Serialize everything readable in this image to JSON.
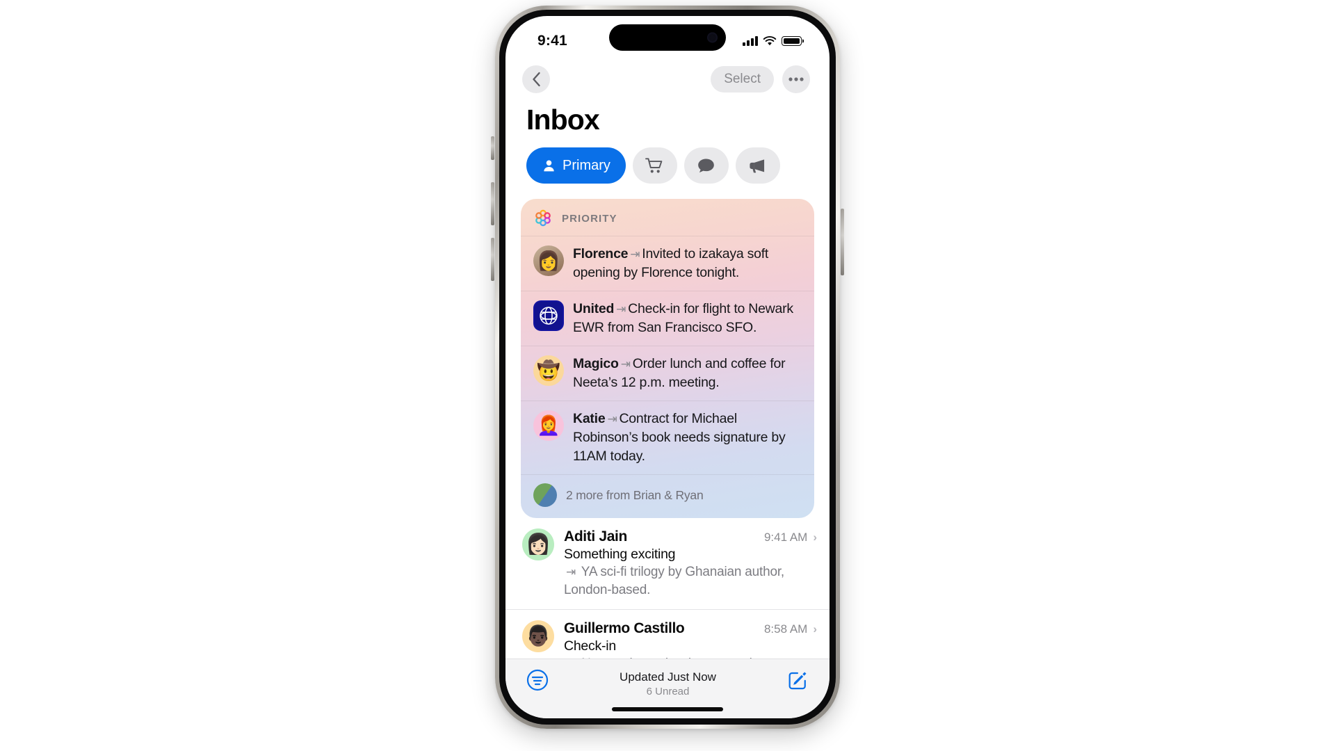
{
  "status_bar": {
    "time": "9:41",
    "cellular_icon": "signal-bars-icon",
    "wifi_icon": "wifi-icon",
    "battery_icon": "battery-full-icon"
  },
  "nav": {
    "back_icon": "chevron-left-icon",
    "select_label": "Select",
    "more_icon": "ellipsis-icon"
  },
  "page_title": "Inbox",
  "filters": [
    {
      "id": "primary",
      "label": "Primary",
      "icon": "person-icon",
      "active": true
    },
    {
      "id": "transactions",
      "label": "",
      "icon": "cart-icon",
      "active": false
    },
    {
      "id": "updates",
      "label": "",
      "icon": "chat-bubble-icon",
      "active": false
    },
    {
      "id": "promotions",
      "label": "",
      "icon": "megaphone-icon",
      "active": false
    }
  ],
  "priority": {
    "header_label": "PRIORITY",
    "header_icon": "apple-intelligence-icon",
    "items": [
      {
        "avatar": "👩",
        "sender": "Florence",
        "summary": "Invited to izakaya soft opening by Florence tonight."
      },
      {
        "avatar": "UA",
        "sender": "United",
        "summary": "Check-in for flight to Newark EWR from San Francisco SFO."
      },
      {
        "avatar": "🤠",
        "sender": "Magico",
        "summary": "Order lunch and coffee for Neeta’s 12 p.m. meeting."
      },
      {
        "avatar": "👩‍🦰",
        "sender": "Katie",
        "summary": "Contract for Michael Robinson’s book needs signature by 11AM today."
      }
    ],
    "more_label": "2 more from Brian & Ryan"
  },
  "messages": [
    {
      "avatar": "👩🏻",
      "sender": "Aditi Jain",
      "time": "9:41 AM",
      "subject": "Something exciting",
      "preview": "YA sci-fi trilogy by Ghanaian author, London-based.",
      "chevron": "chevron-right-icon"
    },
    {
      "avatar": "👨🏿",
      "sender": "Guillermo Castillo",
      "time": "8:58 AM",
      "subject": "Check-in",
      "preview": "Next major review in two weeks. Schedule meeting on Thursday at noon.",
      "chevron": "chevron-right-icon"
    }
  ],
  "bottom_bar": {
    "filter_icon": "mail-filter-icon",
    "updated_label": "Updated Just Now",
    "unread_label": "6 Unread",
    "compose_icon": "compose-icon"
  },
  "colors": {
    "accent": "#0a70e8",
    "pill_inactive": "#e9e9eb",
    "text_primary": "#0a0a0a",
    "text_secondary": "#8a8a8e"
  }
}
